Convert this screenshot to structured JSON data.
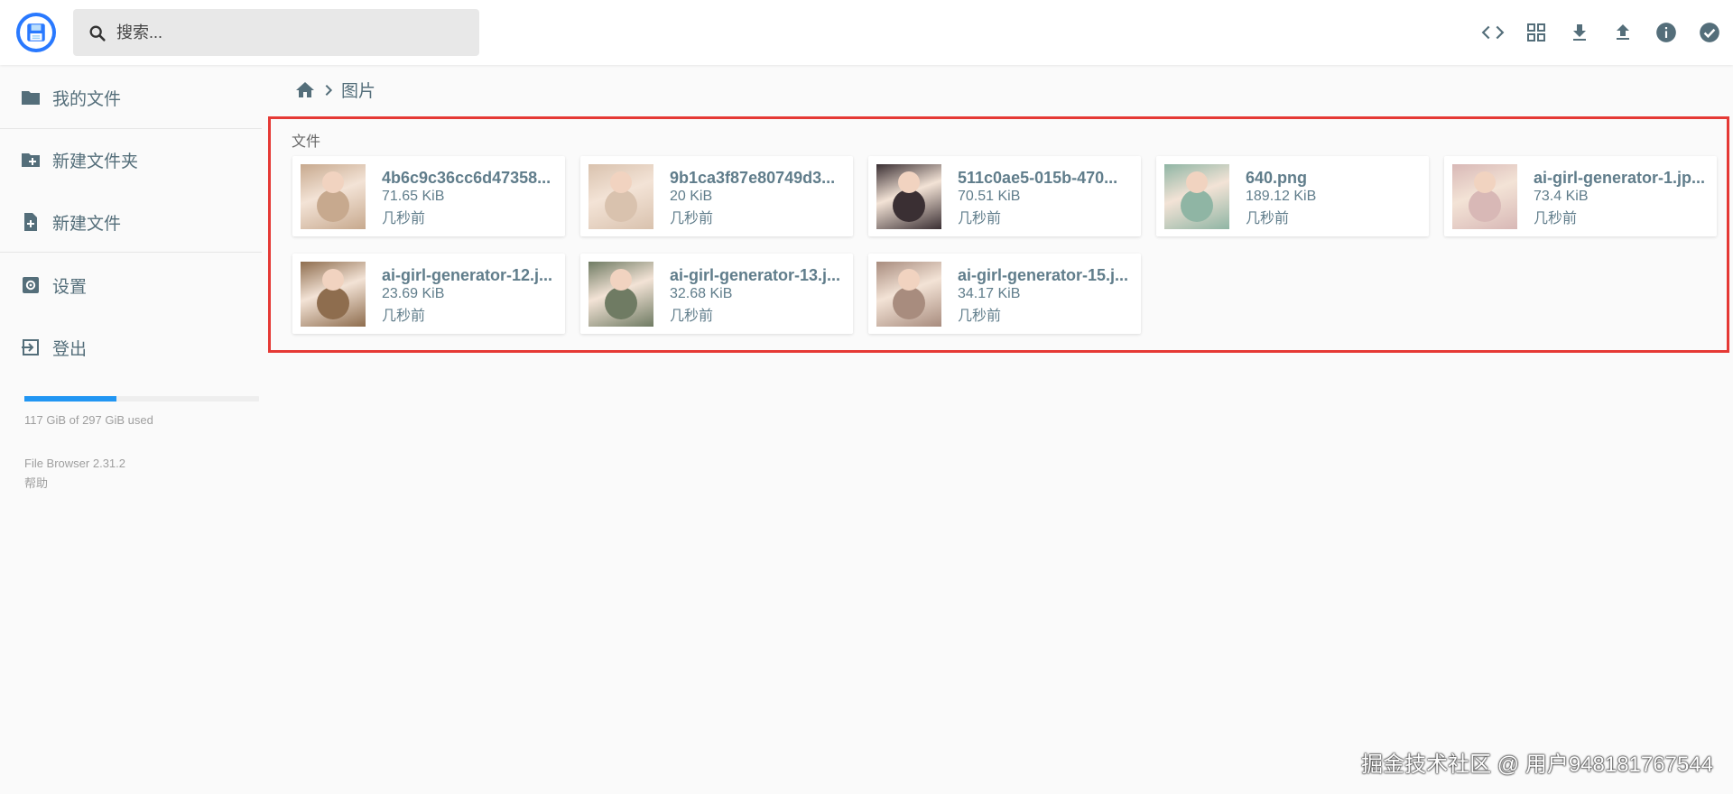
{
  "search": {
    "placeholder": "搜索..."
  },
  "header": {
    "actions": [
      "code-icon",
      "grid-view-icon",
      "download-icon",
      "upload-icon",
      "info-icon",
      "check-circle-icon"
    ]
  },
  "sidebar": {
    "items": [
      {
        "label": "我的文件",
        "icon": "folder-icon"
      },
      {
        "label": "新建文件夹",
        "icon": "new-folder-icon"
      },
      {
        "label": "新建文件",
        "icon": "new-file-icon"
      },
      {
        "label": "设置",
        "icon": "settings-icon"
      },
      {
        "label": "登出",
        "icon": "logout-icon"
      }
    ],
    "usage": {
      "text": "117 GiB of 297 GiB used",
      "fraction": 0.394
    },
    "version": "File Browser 2.31.2",
    "help": "帮助"
  },
  "breadcrumb": {
    "current": "图片"
  },
  "section_label": "文件",
  "files": [
    {
      "name": "4b6c9c36cc6d47358...",
      "size": "71.65 KiB",
      "time": "几秒前",
      "thumb_color": "#c7a98e"
    },
    {
      "name": "9b1ca3f87e80749d3...",
      "size": "20 KiB",
      "time": "几秒前",
      "thumb_color": "#d9c2ae"
    },
    {
      "name": "511c0ae5-015b-470...",
      "size": "70.51 KiB",
      "time": "几秒前",
      "thumb_color": "#3a2f33"
    },
    {
      "name": "640.png",
      "size": "189.12 KiB",
      "time": "几秒前",
      "thumb_color": "#8fb5a4"
    },
    {
      "name": "ai-girl-generator-1.jp...",
      "size": "73.4 KiB",
      "time": "几秒前",
      "thumb_color": "#d8b8b6"
    },
    {
      "name": "ai-girl-generator-12.j...",
      "size": "23.69 KiB",
      "time": "几秒前",
      "thumb_color": "#8e6d4e"
    },
    {
      "name": "ai-girl-generator-13.j...",
      "size": "32.68 KiB",
      "time": "几秒前",
      "thumb_color": "#6f7b63"
    },
    {
      "name": "ai-girl-generator-15.j...",
      "size": "34.17 KiB",
      "time": "几秒前",
      "thumb_color": "#a88c7e"
    }
  ],
  "colors": {
    "accent": "#2196f3",
    "highlight_border": "#e53935",
    "icon": "#546e7a"
  },
  "watermark": "掘金技术社区 @ 用户948181767544"
}
